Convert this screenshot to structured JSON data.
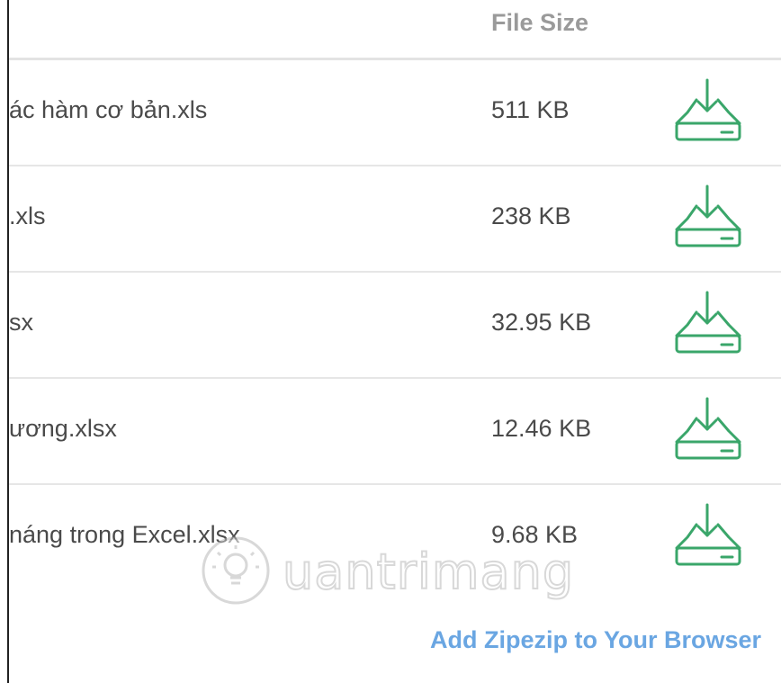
{
  "table": {
    "header": {
      "file_size": "File Size"
    },
    "rows": [
      {
        "name": "ác hàm cơ bản.xls",
        "size": "511 KB"
      },
      {
        "name": ".xls",
        "size": "238 KB"
      },
      {
        "name": "sx",
        "size": "32.95 KB"
      },
      {
        "name": "ương.xlsx",
        "size": "12.46 KB"
      },
      {
        "name": "náng trong Excel.xlsx",
        "size": "9.68 KB"
      }
    ]
  },
  "watermark": {
    "text": "uantrimang"
  },
  "footer": {
    "addon_link": "Add Zipezip to Your Browser"
  },
  "colors": {
    "download_icon": "#3aa66a",
    "link": "#6aa6e2",
    "header_text": "#9a9a9a",
    "body_text": "#4a4a4a"
  },
  "icons": {
    "download": "download-tray-icon",
    "watermark_logo": "lightbulb-logo-icon"
  }
}
